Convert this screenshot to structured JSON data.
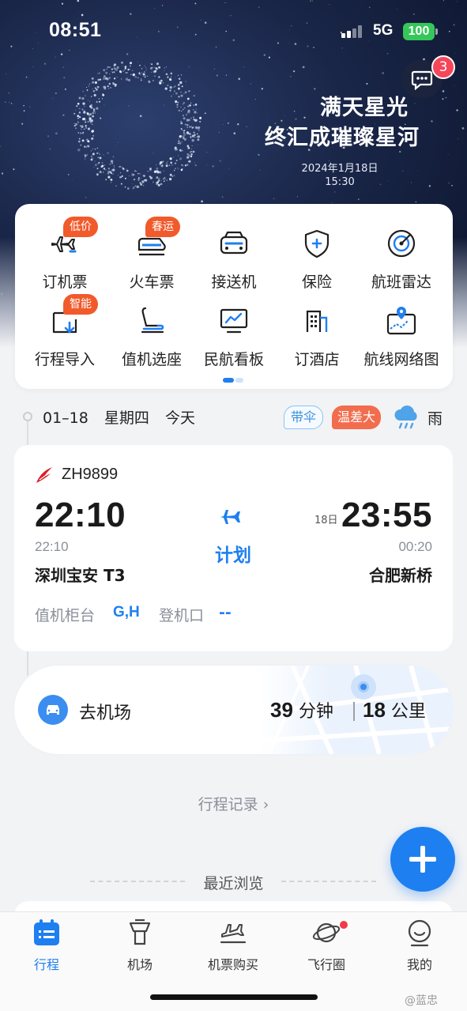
{
  "status_bar": {
    "time": "08:51",
    "network": "5G",
    "battery": "100"
  },
  "messages": {
    "badge_count": "3",
    "icon": "chat-bubble-icon"
  },
  "banner": {
    "title_line1": "满天星光",
    "title_line2": "终汇成璀璨星河",
    "date": "2024年1月18日",
    "time": "15:30"
  },
  "services": [
    {
      "label": "订机票",
      "tag": "低价",
      "icon": "airplane-icon"
    },
    {
      "label": "火车票",
      "tag": "春运",
      "icon": "train-icon"
    },
    {
      "label": "接送机",
      "tag": "",
      "icon": "car-icon"
    },
    {
      "label": "保险",
      "tag": "",
      "icon": "shield-icon"
    },
    {
      "label": "航班雷达",
      "tag": "",
      "icon": "radar-icon"
    },
    {
      "label": "行程导入",
      "tag": "智能",
      "icon": "import-icon"
    },
    {
      "label": "值机选座",
      "tag": "",
      "icon": "seat-icon"
    },
    {
      "label": "民航看板",
      "tag": "",
      "icon": "monitor-icon"
    },
    {
      "label": "订酒店",
      "tag": "",
      "icon": "hotel-icon"
    },
    {
      "label": "航线网络图",
      "tag": "",
      "icon": "map-icon"
    }
  ],
  "day": {
    "date": "01–18",
    "weekday": "星期四",
    "relative": "今天",
    "tag_umbrella": "带伞",
    "tag_temp": "温差大",
    "weather": "雨",
    "weather_icon": "rain-cloud-icon"
  },
  "flight": {
    "number": "ZH9899",
    "dep_time": "22:10",
    "dep_scheduled": "22:10",
    "dep_airport": "深圳宝安 T3",
    "status": "计划",
    "arr_day": "18日",
    "arr_time": "23:55",
    "arr_scheduled": "00:20",
    "arr_airport": "合肥新桥",
    "counter_label": "值机柜台",
    "counter_value": "G,H",
    "gate_label": "登机口",
    "gate_value": "--"
  },
  "to_airport": {
    "label": "去机场",
    "duration_num": "39",
    "duration_unit": "分钟",
    "distance_num": "18",
    "distance_unit": "公里"
  },
  "history_link": "行程记录 ›",
  "recent_label": "最近浏览",
  "tabs": [
    {
      "label": "行程",
      "active": true
    },
    {
      "label": "机场",
      "active": false
    },
    {
      "label": "机票购买",
      "active": false
    },
    {
      "label": "飞行圈",
      "active": false
    },
    {
      "label": "我的",
      "active": false
    }
  ],
  "watermark": "@蓝忠",
  "colors": {
    "accent": "#1e7ff0",
    "tag_orange": "#f15a2b",
    "badge_red": "#f7465a"
  }
}
